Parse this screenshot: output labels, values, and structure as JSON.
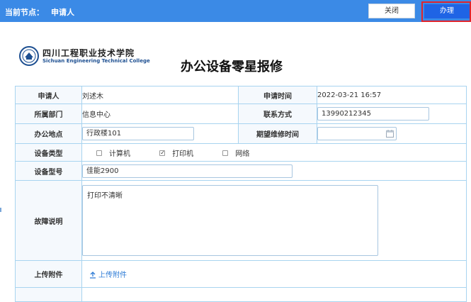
{
  "header": {
    "node_label": "当前节点：",
    "node_value": "申请人",
    "close_label": "关闭",
    "handle_label": "办理"
  },
  "logo": {
    "name_cn": "四川工程职业技术学院",
    "name_en": "Sichuan Engineering Technical College"
  },
  "form": {
    "title": "办公设备零星报修",
    "applicant": {
      "label": "申请人",
      "value": "刘述木"
    },
    "apply_time": {
      "label": "申请时间",
      "value": "2022-03-21 16:57"
    },
    "department": {
      "label": "所属部门",
      "value": "信息中心"
    },
    "contact": {
      "label": "联系方式",
      "value": "13990212345"
    },
    "location": {
      "label": "办公地点",
      "value": "行政楼101"
    },
    "expected_time": {
      "label": "期望维修时间",
      "value": ""
    },
    "device_type": {
      "label": "设备类型",
      "options": [
        {
          "label": "计算机",
          "checked": false
        },
        {
          "label": "打印机",
          "checked": true
        },
        {
          "label": "网络",
          "checked": false
        }
      ]
    },
    "model": {
      "label": "设备型号",
      "value": "佳能2900"
    },
    "fault": {
      "label": "故障说明",
      "value": "打印不清晰"
    },
    "attachment": {
      "label": "上传附件",
      "button": "上传附件"
    }
  },
  "colors": {
    "topbar": "#3b8ae6",
    "primary_button": "#1f64e5",
    "highlight_border": "#e0242c",
    "table_border": "#a8d4f0",
    "link": "#2d7bd6"
  }
}
